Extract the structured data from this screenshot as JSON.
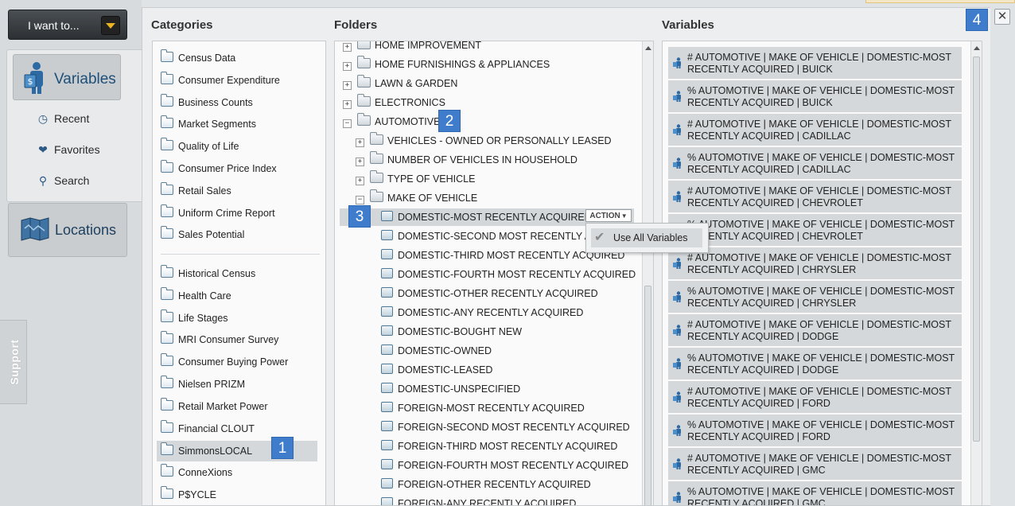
{
  "nav": {
    "i_want_to": "I want to...",
    "variables": "Variables",
    "recent": "Recent",
    "favorites": "Favorites",
    "search": "Search",
    "locations": "Locations",
    "support": "Support"
  },
  "headers": {
    "categories": "Categories",
    "folders": "Folders",
    "variables": "Variables"
  },
  "categories_group1": [
    "Census Data",
    "Consumer Expenditure",
    "Business Counts",
    "Market Segments",
    "Quality of Life",
    "Consumer Price Index",
    "Retail Sales",
    "Uniform Crime Report",
    "Sales Potential"
  ],
  "categories_group2": [
    "Historical Census",
    "Health Care",
    "Life Stages",
    "MRI Consumer Survey",
    "Consumer Buying Power",
    "Nielsen PRIZM",
    "Retail Market Power",
    "Financial CLOUT",
    "SimmonsLOCAL",
    "ConneXions",
    "P$YCLE"
  ],
  "folders_top": [
    {
      "label": "HOME IMPROVEMENT",
      "sign": "+"
    },
    {
      "label": "HOME FURNISHINGS & APPLIANCES",
      "sign": "+"
    },
    {
      "label": "LAWN & GARDEN",
      "sign": "+"
    },
    {
      "label": "ELECTRONICS",
      "sign": "+"
    },
    {
      "label": "AUTOMOTIVE",
      "sign": "−"
    }
  ],
  "folders_auto": [
    {
      "label": "VEHICLES - OWNED OR PERSONALLY LEASED",
      "sign": "+"
    },
    {
      "label": "NUMBER OF VEHICLES IN HOUSEHOLD",
      "sign": "+"
    },
    {
      "label": "TYPE OF VEHICLE",
      "sign": "+"
    },
    {
      "label": "MAKE OF VEHICLE",
      "sign": "−"
    }
  ],
  "folders_make": [
    "DOMESTIC-MOST RECENTLY ACQUIRED",
    "DOMESTIC-SECOND MOST RECENTLY ACQU",
    "DOMESTIC-THIRD MOST RECENTLY ACQUIRED",
    "DOMESTIC-FOURTH MOST RECENTLY ACQUIRED",
    "DOMESTIC-OTHER RECENTLY ACQUIRED",
    "DOMESTIC-ANY RECENTLY ACQUIRED",
    "DOMESTIC-BOUGHT NEW",
    "DOMESTIC-OWNED",
    "DOMESTIC-LEASED",
    "DOMESTIC-UNSPECIFIED",
    "FOREIGN-MOST RECENTLY ACQUIRED",
    "FOREIGN-SECOND MOST RECENTLY ACQUIRED",
    "FOREIGN-THIRD MOST RECENTLY ACQUIRED",
    "FOREIGN-FOURTH MOST RECENTLY ACQUIRED",
    "FOREIGN-OTHER RECENTLY ACQUIRED",
    "FOREIGN-ANY RECENTLY ACQUIRED"
  ],
  "action_label": "ACTION",
  "menu_use_all": "Use All Variables",
  "variables": [
    {
      "line1": "# AUTOMOTIVE | MAKE OF VEHICLE | DOMESTIC-MOST",
      "line2": "RECENTLY ACQUIRED | BUICK"
    },
    {
      "line1": "% AUTOMOTIVE | MAKE OF VEHICLE | DOMESTIC-MOST",
      "line2": "RECENTLY ACQUIRED | BUICK"
    },
    {
      "line1": "# AUTOMOTIVE | MAKE OF VEHICLE | DOMESTIC-MOST",
      "line2": "RECENTLY ACQUIRED | CADILLAC"
    },
    {
      "line1": "% AUTOMOTIVE | MAKE OF VEHICLE | DOMESTIC-MOST",
      "line2": "RECENTLY ACQUIRED | CADILLAC"
    },
    {
      "line1": "# AUTOMOTIVE | MAKE OF VEHICLE | DOMESTIC-MOST",
      "line2": "RECENTLY ACQUIRED | CHEVROLET"
    },
    {
      "line1": "% AUTOMOTIVE | MAKE OF VEHICLE | DOMESTIC-MOST",
      "line2": "RECENTLY ACQUIRED | CHEVROLET"
    },
    {
      "line1": "# AUTOMOTIVE | MAKE OF VEHICLE | DOMESTIC-MOST",
      "line2": "RECENTLY ACQUIRED | CHRYSLER"
    },
    {
      "line1": "% AUTOMOTIVE | MAKE OF VEHICLE | DOMESTIC-MOST",
      "line2": "RECENTLY ACQUIRED | CHRYSLER"
    },
    {
      "line1": "# AUTOMOTIVE | MAKE OF VEHICLE | DOMESTIC-MOST",
      "line2": "RECENTLY ACQUIRED | DODGE"
    },
    {
      "line1": "% AUTOMOTIVE | MAKE OF VEHICLE | DOMESTIC-MOST",
      "line2": "RECENTLY ACQUIRED | DODGE"
    },
    {
      "line1": "# AUTOMOTIVE | MAKE OF VEHICLE | DOMESTIC-MOST",
      "line2": "RECENTLY ACQUIRED | FORD"
    },
    {
      "line1": "% AUTOMOTIVE | MAKE OF VEHICLE | DOMESTIC-MOST",
      "line2": "RECENTLY ACQUIRED | FORD"
    },
    {
      "line1": "# AUTOMOTIVE | MAKE OF VEHICLE | DOMESTIC-MOST",
      "line2": "RECENTLY ACQUIRED | GMC"
    },
    {
      "line1": "% AUTOMOTIVE | MAKE OF VEHICLE | DOMESTIC-MOST",
      "line2": "RECENTLY ACQUIRED | GMC"
    }
  ],
  "badges": {
    "b1": "1",
    "b2": "2",
    "b3": "3",
    "b4": "4"
  },
  "close_glyph": "✕",
  "colors": {
    "accent": "#3f7ccc",
    "nav_text": "#1d4f78"
  }
}
